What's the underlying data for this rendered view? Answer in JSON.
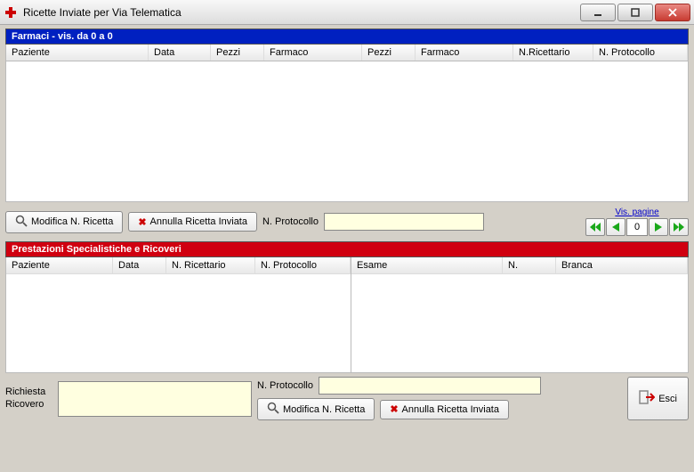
{
  "window": {
    "title": "Ricette Inviate per Via Telematica"
  },
  "section1": {
    "title": "Farmaci - vis. da 0 a 0",
    "columns": [
      "Paziente",
      "Data",
      "Pezzi",
      "Farmaco",
      "Pezzi",
      "Farmaco",
      "N.Ricettario",
      "N. Protocollo"
    ]
  },
  "toolbar1": {
    "modifica": "Modifica N. Ricetta",
    "annulla": "Annulla Ricetta Inviata",
    "protocollo_label": "N. Protocollo",
    "protocollo_value": "",
    "vis_pagine": "Vis. pagine",
    "page": "0"
  },
  "section2": {
    "title": "Prestazioni Specialistiche e Ricoveri",
    "left_columns": [
      "Paziente",
      "Data",
      "N. Ricettario",
      "N. Protocollo"
    ],
    "right_columns": [
      "Esame",
      "N.",
      "Branca"
    ]
  },
  "bottom": {
    "richiesta_label": "Richiesta Ricovero",
    "richiesta_value": "",
    "protocollo_label": "N. Protocollo",
    "protocollo_value": "",
    "modifica": "Modifica N. Ricetta",
    "annulla": "Annulla Ricetta Inviata",
    "esci": "Esci"
  }
}
